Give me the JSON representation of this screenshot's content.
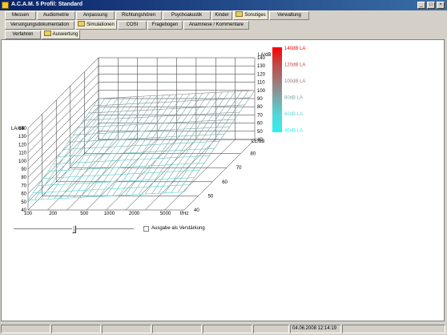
{
  "window": {
    "title": "A.C.A.M. 5 Profil: Standard"
  },
  "tabs_main": [
    "Messen",
    "Audiometrie",
    "Anpassung",
    "Richtungshören",
    "Psychoakustik",
    "Kinder",
    "Sonstiges",
    "Verwaltung"
  ],
  "tabs_sub": [
    "Versorgungsdokumentation",
    "Simulationen",
    "COSI",
    "Fragebogen",
    "Anamnese / Kommentare"
  ],
  "tabs_inner": [
    "Verfahren",
    "Auswertung"
  ],
  "chart": {
    "freq_labels": [
      "100",
      "200",
      "500",
      "1000",
      "2000",
      "5000",
      "f/Hz"
    ],
    "la_labels": [
      "40",
      "50",
      "60",
      "70",
      "80",
      "90",
      "100",
      "110",
      "120",
      "130",
      "140"
    ],
    "la_axis_title": "LA/dB",
    "le_labels": [
      "40",
      "50",
      "60",
      "70",
      "80"
    ],
    "le_axis_title": "LE/dB",
    "colorbar_labels": [
      "140dB LA",
      "120dB LA",
      "100dB LA",
      "80dB LA",
      "60dB LA",
      "40dB LA"
    ],
    "colorbar_colors": [
      "#ff0000",
      "#c04848",
      "#a07878",
      "#7aa8a8",
      "#50d8d8",
      "#30f0f0"
    ]
  },
  "chart_data": {
    "type": "surface",
    "x_label": "f/Hz",
    "x_ticks": [
      100,
      200,
      500,
      1000,
      2000,
      5000
    ],
    "x_scale": "log",
    "y_label": "LE/dB",
    "y_ticks": [
      40,
      50,
      60,
      70,
      80
    ],
    "z_label": "LA/dB",
    "z_range": [
      40,
      140
    ],
    "colorscale": [
      [
        40,
        "#30f0f0"
      ],
      [
        60,
        "#50d8d8"
      ],
      [
        80,
        "#7aa8a8"
      ],
      [
        100,
        "#a07878"
      ],
      [
        120,
        "#c04848"
      ],
      [
        140,
        "#ff0000"
      ]
    ]
  },
  "controls": {
    "checkbox_label": "Ausgabe als Verstärkung",
    "checkbox_checked": false
  },
  "status": {
    "datetime": "04.06.2008 12:14:19"
  }
}
